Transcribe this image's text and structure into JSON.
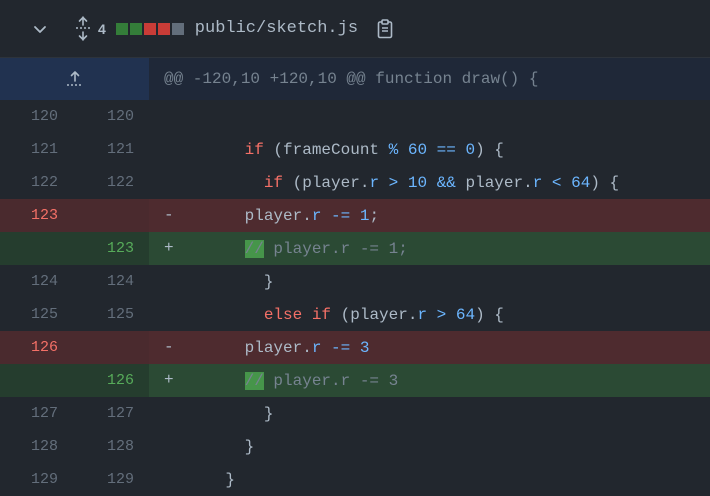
{
  "header": {
    "count": "4",
    "filename": "public/sketch.js",
    "diffstat_colors": [
      "#347d39",
      "#347d39",
      "#c93c37",
      "#c93c37",
      "#636e7b"
    ]
  },
  "hunk": {
    "text": "@@ -120,10 +120,10 @@ function draw() {"
  },
  "rows": [
    {
      "type": "ctx",
      "old": "120",
      "new": "120",
      "sign": "",
      "tokens": []
    },
    {
      "type": "ctx",
      "old": "121",
      "new": "121",
      "sign": "",
      "tokens": [
        [
          "",
          "      "
        ],
        [
          "kw",
          "if"
        ],
        [
          "",
          " (frameCount "
        ],
        [
          "op",
          "%"
        ],
        [
          "",
          " "
        ],
        [
          "num",
          "60"
        ],
        [
          "",
          " "
        ],
        [
          "op",
          "=="
        ],
        [
          "",
          " "
        ],
        [
          "num",
          "0"
        ],
        [
          "",
          ") {"
        ]
      ]
    },
    {
      "type": "ctx",
      "old": "122",
      "new": "122",
      "sign": "",
      "tokens": [
        [
          "",
          "        "
        ],
        [
          "kw",
          "if"
        ],
        [
          "",
          " (player."
        ],
        [
          "prop",
          "r"
        ],
        [
          "",
          " "
        ],
        [
          "op",
          ">"
        ],
        [
          "",
          " "
        ],
        [
          "num",
          "10"
        ],
        [
          "",
          " "
        ],
        [
          "op",
          "&&"
        ],
        [
          "",
          " player."
        ],
        [
          "prop",
          "r"
        ],
        [
          "",
          " "
        ],
        [
          "op",
          "<"
        ],
        [
          "",
          " "
        ],
        [
          "num",
          "64"
        ],
        [
          "",
          ") {"
        ]
      ]
    },
    {
      "type": "del",
      "old": "123",
      "new": "",
      "sign": "-",
      "tokens": [
        [
          "",
          "      player."
        ],
        [
          "prop",
          "r"
        ],
        [
          "",
          " "
        ],
        [
          "op",
          "-="
        ],
        [
          "",
          " "
        ],
        [
          "num",
          "1"
        ],
        [
          "",
          ";"
        ]
      ]
    },
    {
      "type": "add",
      "old": "",
      "new": "123",
      "sign": "+",
      "tokens": [
        [
          "",
          "      "
        ],
        [
          "mark",
          "//"
        ],
        [
          "cmt",
          " player.r -= 1;"
        ]
      ]
    },
    {
      "type": "ctx",
      "old": "124",
      "new": "124",
      "sign": "",
      "tokens": [
        [
          "",
          "        }"
        ]
      ]
    },
    {
      "type": "ctx",
      "old": "125",
      "new": "125",
      "sign": "",
      "tokens": [
        [
          "",
          "        "
        ],
        [
          "kw",
          "else if"
        ],
        [
          "",
          " (player."
        ],
        [
          "prop",
          "r"
        ],
        [
          "",
          " "
        ],
        [
          "op",
          ">"
        ],
        [
          "",
          " "
        ],
        [
          "num",
          "64"
        ],
        [
          "",
          ") {"
        ]
      ]
    },
    {
      "type": "del",
      "old": "126",
      "new": "",
      "sign": "-",
      "tokens": [
        [
          "",
          "      player."
        ],
        [
          "prop",
          "r"
        ],
        [
          "",
          " "
        ],
        [
          "op",
          "-="
        ],
        [
          "",
          " "
        ],
        [
          "num",
          "3"
        ]
      ]
    },
    {
      "type": "add",
      "old": "",
      "new": "126",
      "sign": "+",
      "tokens": [
        [
          "",
          "      "
        ],
        [
          "mark",
          "//"
        ],
        [
          "cmt",
          " player.r -= 3"
        ]
      ]
    },
    {
      "type": "ctx",
      "old": "127",
      "new": "127",
      "sign": "",
      "tokens": [
        [
          "",
          "        }"
        ]
      ]
    },
    {
      "type": "ctx",
      "old": "128",
      "new": "128",
      "sign": "",
      "tokens": [
        [
          "",
          "      }"
        ]
      ]
    },
    {
      "type": "ctx",
      "old": "129",
      "new": "129",
      "sign": "",
      "tokens": [
        [
          "",
          "    }"
        ]
      ]
    }
  ]
}
